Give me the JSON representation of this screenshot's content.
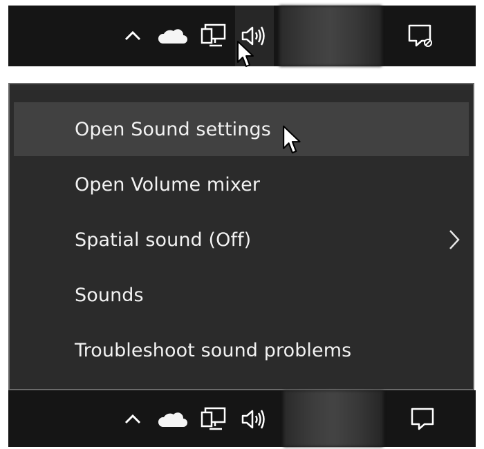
{
  "menu": {
    "items": [
      {
        "label": "Open Sound settings",
        "hovered": true,
        "has_submenu": false
      },
      {
        "label": "Open Volume mixer",
        "hovered": false,
        "has_submenu": false
      },
      {
        "label": "Spatial sound (Off)",
        "hovered": false,
        "has_submenu": true
      },
      {
        "label": "Sounds",
        "hovered": false,
        "has_submenu": false
      },
      {
        "label": "Troubleshoot sound problems",
        "hovered": false,
        "has_submenu": false
      }
    ]
  },
  "taskbar": {
    "tray_icons": [
      "chevron-up-icon",
      "onedrive-cloud-icon",
      "network-icon",
      "volume-icon"
    ],
    "notification_icon": "action-center-icon"
  },
  "colors": {
    "taskbar_bg": "#151515",
    "menu_bg": "#2b2b2b",
    "menu_hover_bg": "#414141",
    "menu_border": "#6a6a6a",
    "text": "#f2f2f2"
  }
}
